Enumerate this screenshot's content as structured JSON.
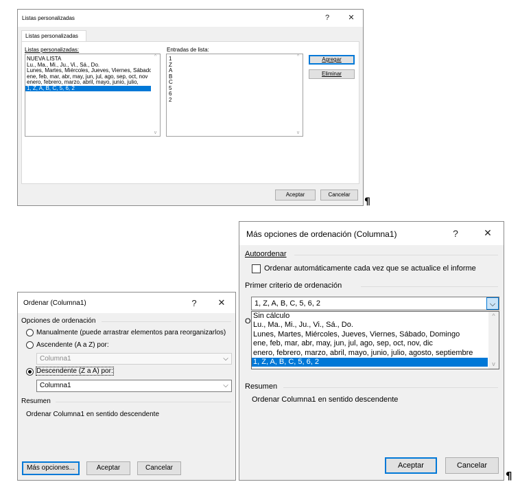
{
  "custom_lists_dialog": {
    "title": "Listas personalizadas",
    "help": "?",
    "close": "✕",
    "tab": "Listas personalizadas",
    "lists_label": "Listas personalizadas:",
    "entries_label": "Entradas de lista:",
    "lists": [
      "NUEVA LISTA",
      "Lu., Ma., Mi., Ju., Vi., Sá., Do.",
      "Lunes, Martes, Miércoles, Jueves, Viernes, Sábado",
      "ene, feb, mar, abr, may, jun, jul, ago, sep, oct, nov",
      "enero, febrero, marzo, abril, mayo, junio, julio,",
      "1, Z, A, B, C, 5, 6, 2"
    ],
    "selected_index": 5,
    "entries": [
      "1",
      "Z",
      "A",
      "B",
      "C",
      "5",
      "6",
      "2"
    ],
    "add_button": "Agregar",
    "delete_button": "Eliminar",
    "ok_button": "Aceptar",
    "cancel_button": "Cancelar"
  },
  "sort_dialog": {
    "title": "Ordenar (Columna1)",
    "help": "?",
    "close": "✕",
    "options_group": "Opciones de ordenación",
    "manual_label": "Manualmente (puede arrastrar elementos para reorganizarlos)",
    "ascending_label": "Ascendente (A a Z) por:",
    "ascending_value": "Columna1",
    "descending_label": "Descendente (Z a A) por:",
    "descending_value": "Columna1",
    "summary_group": "Resumen",
    "summary_text": "Ordenar Columna1 en sentido descendente",
    "more_options_button": "Más opciones...",
    "ok_button": "Aceptar",
    "cancel_button": "Cancelar"
  },
  "more_options_dialog": {
    "title": "Más opciones de ordenación (Columna1)",
    "help": "?",
    "close": "✕",
    "autosort_group": "Autoordenar",
    "autosort_checkbox": "Ordenar automáticamente cada vez que se actualice el informe",
    "first_key_group": "Primer criterio de ordenación",
    "first_key_value": "1, Z, A, B, C, 5, 6, 2",
    "dropdown_options": [
      "Sin cálculo",
      "Lu., Ma., Mi., Ju., Vi., Sá., Do.",
      "Lunes, Martes, Miércoles, Jueves, Viernes, Sábado, Domingo",
      "ene, feb, mar, abr, may, jun, jul, ago, sep, oct, nov, dic",
      "enero, febrero, marzo, abril, mayo, junio, julio, agosto, septiembre",
      "1, Z, A, B, C, 5, 6, 2"
    ],
    "dropdown_selected_index": 5,
    "summary_group": "Resumen",
    "summary_text": "Ordenar Columna1 en sentido descendente",
    "ok_button": "Aceptar",
    "cancel_button": "Cancelar"
  },
  "document_marks": {
    "pilcrow": "¶"
  },
  "colors": {
    "selection": "#0078d7",
    "dialog_bg": "#f0f0f0",
    "button_bg": "#e1e1e1"
  }
}
